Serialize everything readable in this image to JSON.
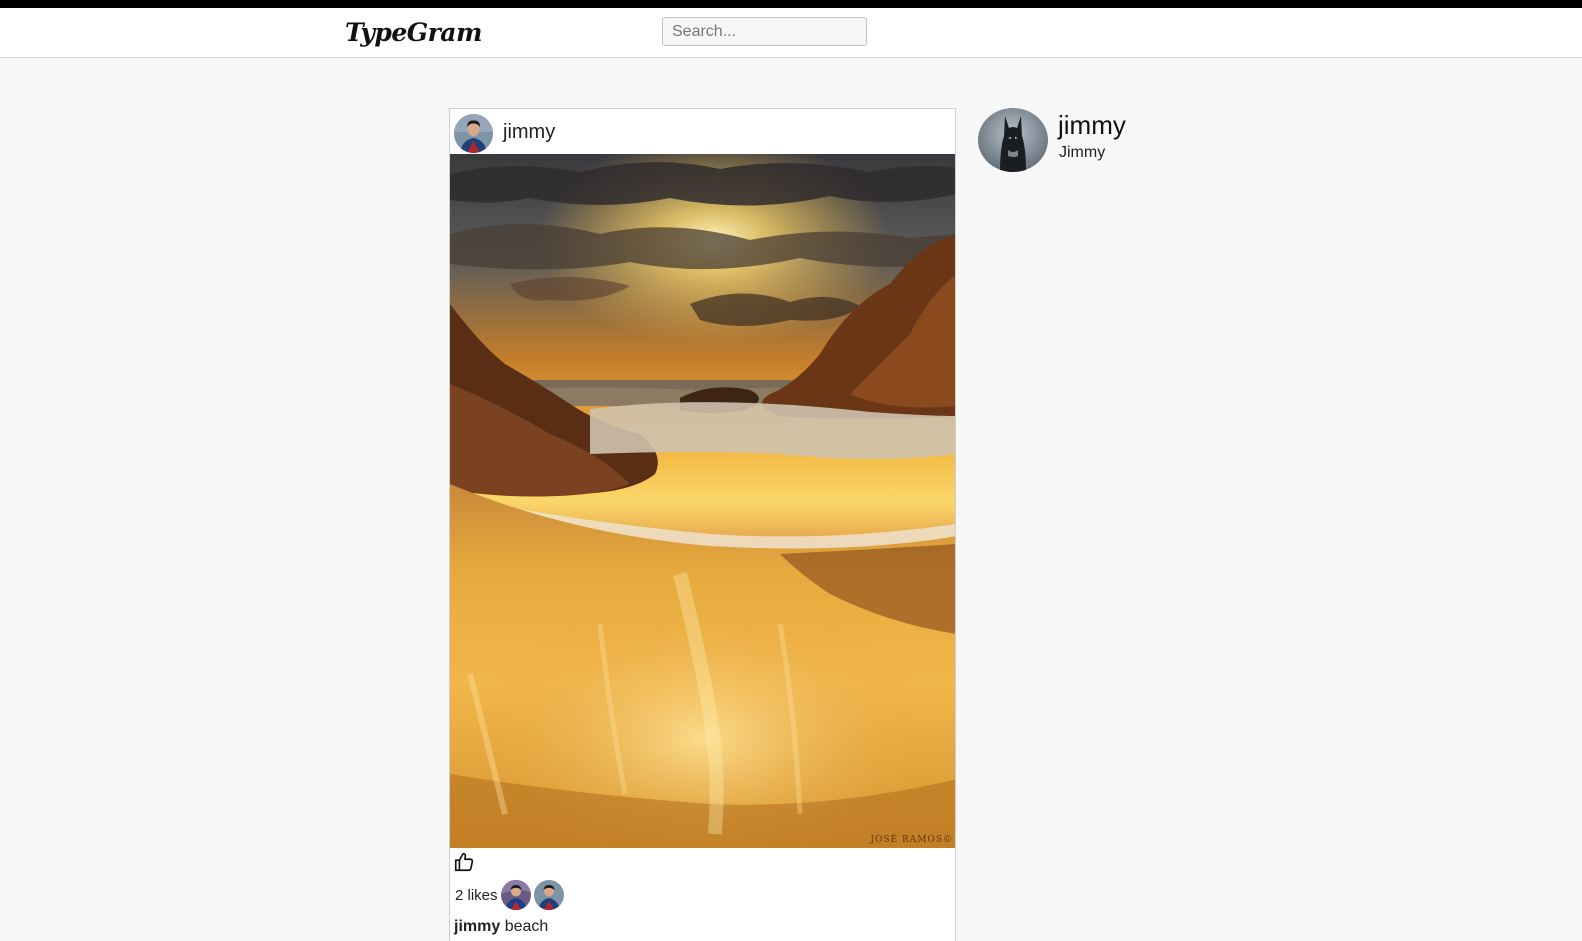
{
  "app": {
    "logo": "TypeGram"
  },
  "search": {
    "placeholder": "Search..."
  },
  "post": {
    "username": "jimmy",
    "likes_text": "2 likes",
    "caption_user": "jimmy",
    "caption_text": "beach",
    "watermark": "JOSÉ RAMOS©",
    "likers": [
      "liker-avatar",
      "liker-avatar"
    ]
  },
  "profile": {
    "username": "jimmy",
    "full_name": "Jimmy"
  },
  "icons": {
    "like": "thumbs-up-icon"
  },
  "colors": {
    "top_bar": "#000000",
    "header_bg": "#ffffff",
    "page_bg": "#f7f7f7"
  }
}
